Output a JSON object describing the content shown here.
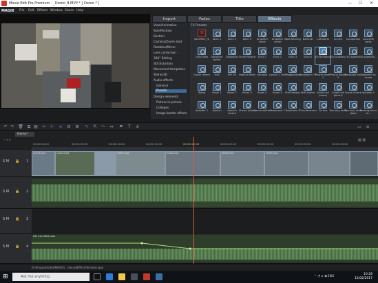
{
  "window": {
    "title": "Movie Edit Pro Premium - _Demo_8.MVP * [ Demo * ]",
    "app_logo": "MAGIX"
  },
  "menu": [
    "File",
    "Edit",
    "Effects",
    "Window",
    "Share",
    "Help"
  ],
  "tabs": [
    "Import",
    "Fades",
    "Title",
    "Effects"
  ],
  "active_tab": "Effects",
  "categories": [
    "View/Animation",
    "Size/Position",
    "Section",
    "Camera/Zoom shot",
    "Rotation/Mirror",
    "Lens correction",
    "360° Editing",
    "3D distortion",
    "Movement templates",
    "Stereo3D",
    "Audio effects",
    "General",
    "Presets",
    "Design elements",
    "Picture-in-picture",
    "Collages",
    "Image border effects"
  ],
  "selected_category": "Presets",
  "fx_header": "FX   Presets",
  "presets": [
    [
      "No effect_fx",
      "Alien 1",
      "Alien 2",
      "Alien 3",
      "Amplifier stack",
      "Amplifier small",
      "Bass filtering",
      "Bathtub",
      "Cathedral",
      "Church",
      "Companion",
      "Concrete walls"
    ],
    [
      "Dirty lead",
      "Distorted guitar",
      "Distortion",
      "Drum Reverb",
      "Echo 1",
      "Echo 2",
      "Echo 3",
      "Echo 4",
      "EQ Brilliance",
      "EQ loudness",
      "EQ speech",
      "EQ speech&..."
    ],
    [
      "Guitar reverb",
      "Hall",
      "HiFi EQ",
      "Highcut 8kHz",
      "Karaoke",
      "Lowcut 1 kHz",
      "Megaphone",
      "Neighbor's TV",
      "Phone booth 1",
      "Phone booth 2",
      "Radiolike hiss",
      "Reporter on scene"
    ],
    [
      "Robot",
      "Room 1",
      "Room 2",
      "Room 3",
      "Room 4",
      "Room 5",
      "Shift deeper",
      "Shift higher",
      "Small hall (close)",
      "Small hall (direct)",
      "Space reverb",
      "Speaker 1"
    ],
    [
      "Speaker 2",
      "Speech",
      "Speech reverb",
      "Stereo (wide)",
      "Stereo splitter",
      "Telephone 1",
      "Telephone 2",
      "Thunderstorm",
      "Tin box",
      "Two-way radio",
      "Two-way radio (bad)",
      "Underground at..."
    ]
  ],
  "selected_preset": "EQ Brilliance",
  "timeline": {
    "project_tab": "Demo*",
    "timecodes": [
      "00:00:00.00",
      "00:00:05.00",
      "00:00:10.00",
      "00:00:15.00",
      "00:00:20.00",
      "00:00:25.00",
      "00:00:30.00",
      "00:00:35.00",
      "00:00:40.00"
    ],
    "playhead_tc": "00:00:20.08",
    "track_header_controls": "S M",
    "tracks": [
      1,
      2,
      3,
      4
    ],
    "clip_labels": [
      "cyclist.mp4",
      "cyclist.mp4",
      "traffic.mp4",
      "traffic.mp4",
      "street.mp4",
      "street.mp4"
    ],
    "audio_label": "Hall (rev effect).wav"
  },
  "statusbar_text": "D:\\ProgramData\\MAGIX\\...\\SoundEffects\\Echoes.wav",
  "taskbar": {
    "search_placeholder": "Ask me anything",
    "time": "10:28",
    "date": "12/02/2017"
  },
  "colors": {
    "accent": "#3f6b94",
    "playhead": "#e05a3a",
    "audio_wave": "#8fd08a"
  }
}
